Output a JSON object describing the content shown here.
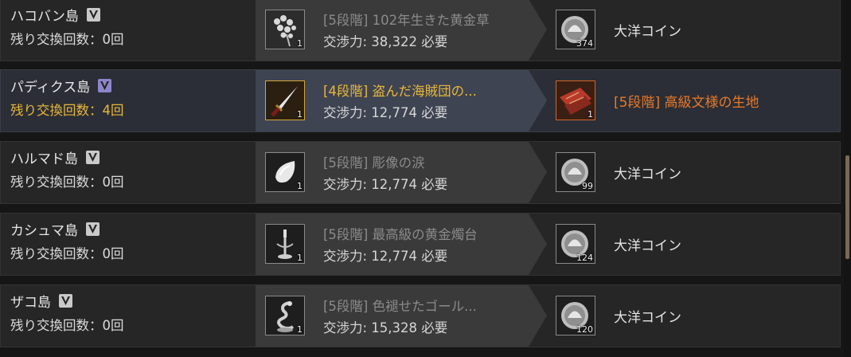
{
  "rows": [
    {
      "island": "ハコバン島",
      "remaining": "残り交換回数：0回",
      "item": {
        "name": "[5段階] 102年生きた黄金草",
        "cost": "交渉力: 38,322 必要",
        "qty": "1",
        "icon": "golden-herb-icon"
      },
      "reward": {
        "name": "大洋コイン",
        "qty": "374",
        "icon": "ocean-coin-icon"
      }
    },
    {
      "island": "パディクス島",
      "remaining": "残り交換回数：4回",
      "item": {
        "name": "[4段階] 盗んだ海賊団の...",
        "cost": "交渉力: 12,774 必要",
        "qty": "1",
        "icon": "dagger-icon"
      },
      "reward": {
        "name": "[5段階] 高級文様の生地",
        "qty": "1",
        "icon": "fabric-icon"
      }
    },
    {
      "island": "ハルマド島",
      "remaining": "残り交換回数：0回",
      "item": {
        "name": "[5段階] 彫像の涙",
        "cost": "交渉力: 12,774 必要",
        "qty": "1",
        "icon": "teardrop-gem-icon"
      },
      "reward": {
        "name": "大洋コイン",
        "qty": "99",
        "icon": "ocean-coin-icon"
      }
    },
    {
      "island": "カシュマ島",
      "remaining": "残り交換回数：0回",
      "item": {
        "name": "[5段階] 最高級の黄金燭台",
        "cost": "交渉力: 12,774 必要",
        "qty": "1",
        "icon": "candlestick-icon"
      },
      "reward": {
        "name": "大洋コイン",
        "qty": "124",
        "icon": "ocean-coin-icon"
      }
    },
    {
      "island": "ザコ島",
      "remaining": "残り交換回数：0回",
      "item": {
        "name": "[5段階] 色褪せたゴール...",
        "cost": "交渉力: 15,328 必要",
        "qty": "1",
        "icon": "dragon-statue-icon"
      },
      "reward": {
        "name": "大洋コイン",
        "qty": "120",
        "icon": "ocean-coin-icon"
      }
    }
  ],
  "colors": {
    "highlight_text": "#e8b73a",
    "rare_reward": "#e8792a",
    "row_bg": "#262626",
    "active_row_bg": "#2b2e36"
  }
}
